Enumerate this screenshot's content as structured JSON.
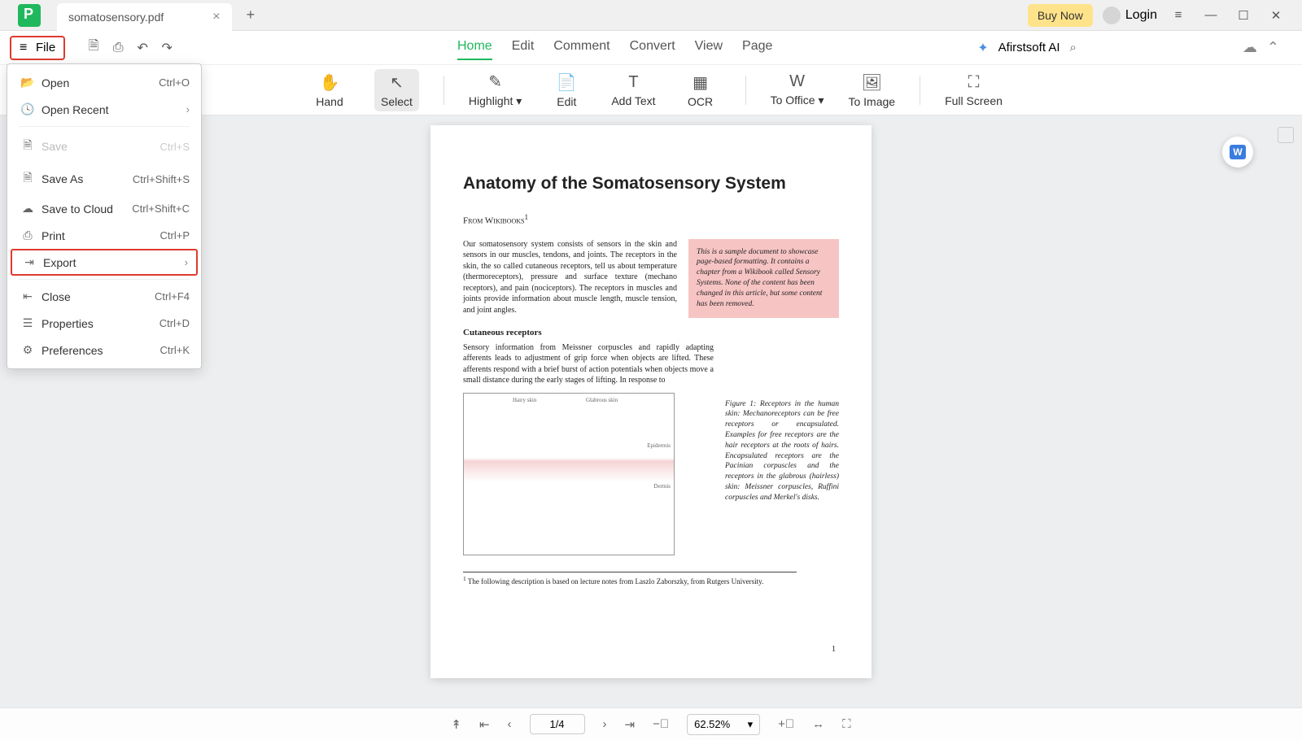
{
  "titlebar": {
    "tab_title": "somatosensory.pdf",
    "buy_now": "Buy Now",
    "login": "Login"
  },
  "toolbar": {
    "file_label": "File",
    "main_tabs": [
      "Home",
      "Edit",
      "Comment",
      "Convert",
      "View",
      "Page"
    ],
    "active_tab": "Home",
    "ai_label": "Afirstsoft AI"
  },
  "ribbon": {
    "hand": "Hand",
    "select": "Select",
    "highlight": "Highlight",
    "edit": "Edit",
    "add_text": "Add Text",
    "ocr": "OCR",
    "to_office": "To Office",
    "to_image": "To Image",
    "full_screen": "Full Screen"
  },
  "file_menu": {
    "open": {
      "label": "Open",
      "shortcut": "Ctrl+O"
    },
    "open_recent": {
      "label": "Open Recent"
    },
    "save": {
      "label": "Save",
      "shortcut": "Ctrl+S"
    },
    "save_as": {
      "label": "Save As",
      "shortcut": "Ctrl+Shift+S"
    },
    "save_to_cloud": {
      "label": "Save to Cloud",
      "shortcut": "Ctrl+Shift+C"
    },
    "print": {
      "label": "Print",
      "shortcut": "Ctrl+P"
    },
    "export": {
      "label": "Export"
    },
    "close": {
      "label": "Close",
      "shortcut": "Ctrl+F4"
    },
    "properties": {
      "label": "Properties",
      "shortcut": "Ctrl+D"
    },
    "preferences": {
      "label": "Preferences",
      "shortcut": "Ctrl+K"
    }
  },
  "document": {
    "title": "Anatomy of the Somatosensory System",
    "source_label": "From Wikibooks",
    "para1": "Our somatosensory system consists of sensors in the skin and sensors in our muscles, tendons, and joints. The receptors in the skin, the so called cutaneous receptors, tell us about temperature (thermoreceptors), pressure and surface texture (mechano receptors), and pain (nociceptors). The receptors in muscles and joints provide information about muscle length, muscle tension, and joint angles.",
    "sidebox": "This is a sample document to showcase page-based formatting. It contains a chapter from a Wikibook called Sensory Systems. None of the content has been changed in this article, but some content has been removed.",
    "subhead": "Cutaneous receptors",
    "para2": "Sensory information from Meissner corpuscles and rapidly adapting afferents leads to adjustment of grip force when objects are lifted. These afferents respond with a brief burst of action potentials when objects move a small distance during the early stages of lifting. In response to",
    "fig_caption": "Figure 1: Receptors in the human skin: Mechanoreceptors can be free receptors or encapsulated. Examples for free receptors are the hair receptors at the roots of hairs. Encapsulated receptors are the Pacinian corpuscles and the receptors in the glabrous (hairless) skin: Meissner corpuscles, Ruffini corpuscles and Merkel's disks.",
    "footnote_marker": "1",
    "footnote": " The following description is based on lecture notes from Laszlo Zaborszky, from Rutgers University.",
    "page_number": "1"
  },
  "bottom": {
    "page_display": "1/4",
    "zoom": "62.52%"
  }
}
